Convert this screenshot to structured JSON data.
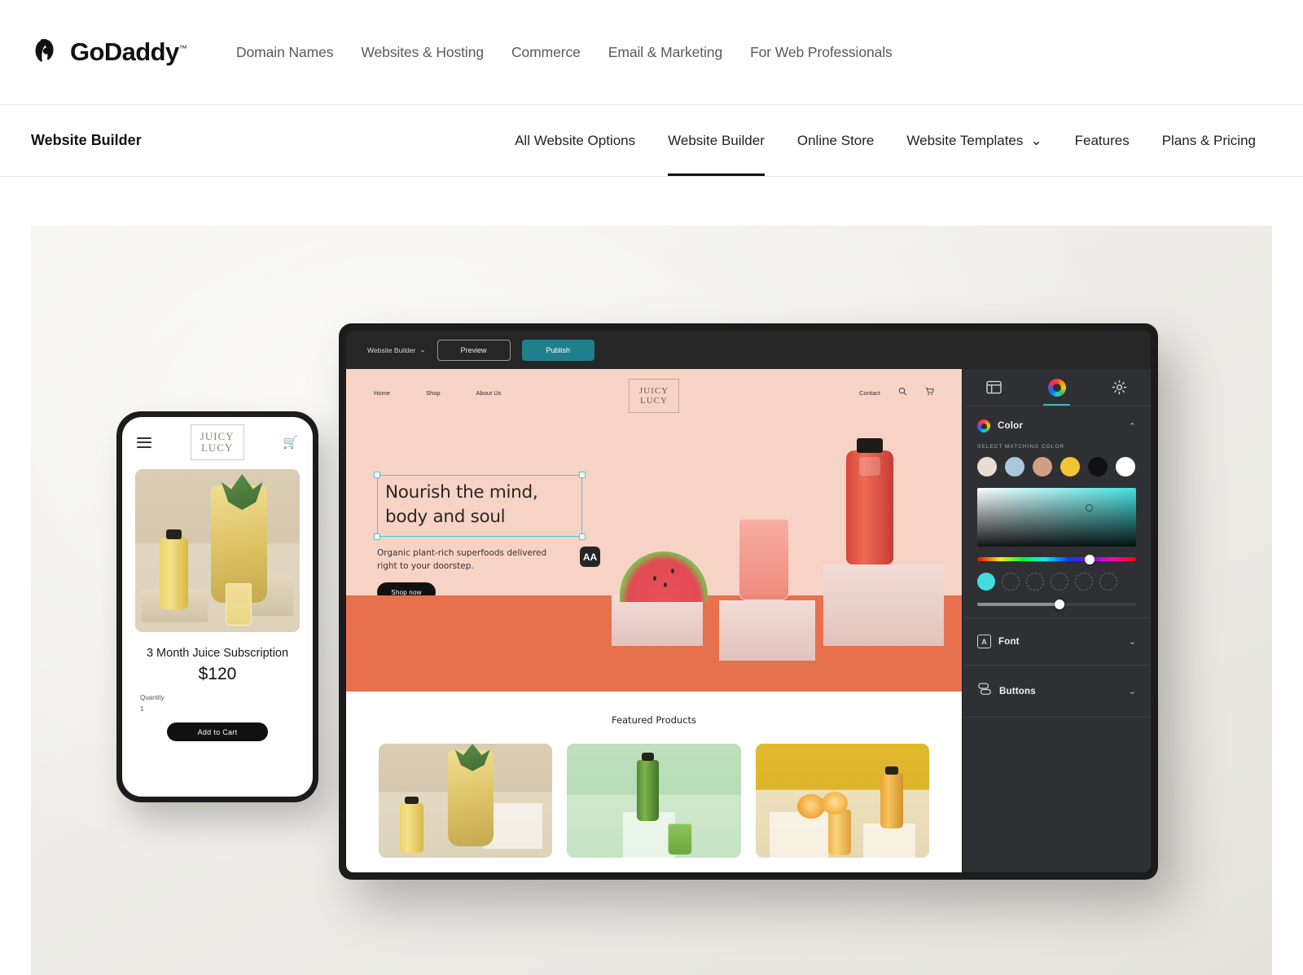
{
  "brand": {
    "name": "GoDaddy",
    "tm": "™",
    "logo_icon": "godaddy-logo-icon"
  },
  "topnav": {
    "links": [
      {
        "label": "Domain Names"
      },
      {
        "label": "Websites & Hosting"
      },
      {
        "label": "Commerce"
      },
      {
        "label": "Email & Marketing"
      },
      {
        "label": "For Web Professionals"
      }
    ]
  },
  "subnav": {
    "title": "Website Builder",
    "links": [
      {
        "label": "All Website Options",
        "active": false,
        "caret": ""
      },
      {
        "label": "Website Builder",
        "active": true,
        "caret": ""
      },
      {
        "label": "Online Store",
        "active": false,
        "caret": ""
      },
      {
        "label": "Website Templates",
        "active": false,
        "caret": "⌄"
      },
      {
        "label": "Features",
        "active": false,
        "caret": ""
      },
      {
        "label": "Plans & Pricing",
        "active": false,
        "caret": ""
      }
    ]
  },
  "phone": {
    "menu_icon": "hamburger-menu-icon",
    "cart_icon": "shopping-cart-icon",
    "logo_line1": "JUICY",
    "logo_line2": "LUCY",
    "product_title": "3 Month Juice Subscription",
    "product_price": "$120",
    "quantity_label": "Quantity",
    "quantity_value": "1",
    "add_to_cart": "Add to Cart"
  },
  "builder": {
    "toolbar": {
      "app_select": "Website Builder",
      "app_select_caret": "⌄",
      "preview": "Preview",
      "publish": "Publish",
      "publish_color": "#1f7f8c"
    },
    "site": {
      "nav_links": [
        "Home",
        "Shop",
        "About Us"
      ],
      "nav_contact": "Contact",
      "search_icon": "search-icon",
      "cart_icon": "shopping-cart-icon",
      "logo_line1": "JUICY",
      "logo_line2": "LUCY",
      "headline": "Nourish the mind, body and soul",
      "subtitle": "Organic plant-rich superfoods delivered right to your doorstep.",
      "cta": "Shop now",
      "format_badge": "AA",
      "hero_bg": "#f7d3c6",
      "hero_floor": "#e8714d",
      "featured_heading": "Featured Products"
    },
    "panel": {
      "tabs": [
        {
          "icon": "page-layout-icon",
          "active": false
        },
        {
          "icon": "color-wheel-icon",
          "active": true
        },
        {
          "icon": "gear-icon",
          "active": false
        }
      ],
      "color": {
        "title": "Color",
        "icon": "color-wheel-icon",
        "collapse_caret": "⌃",
        "select_label": "SELECT MATCHING COLOR",
        "swatches": [
          "#e8ddd0",
          "#a8c8dc",
          "#d29e84",
          "#f2c335",
          "#111111",
          "#ffffff"
        ],
        "picked_color": "#45dce0",
        "hue_position_pct": 71,
        "alpha_position_pct": 52,
        "slot_count": 6,
        "filled_slots": 1
      },
      "font": {
        "title": "Font",
        "icon": "font-letter-a-icon",
        "caret": "⌄"
      },
      "buttons": {
        "title": "Buttons",
        "icon": "button-shape-icon",
        "caret": "⌄"
      }
    }
  }
}
